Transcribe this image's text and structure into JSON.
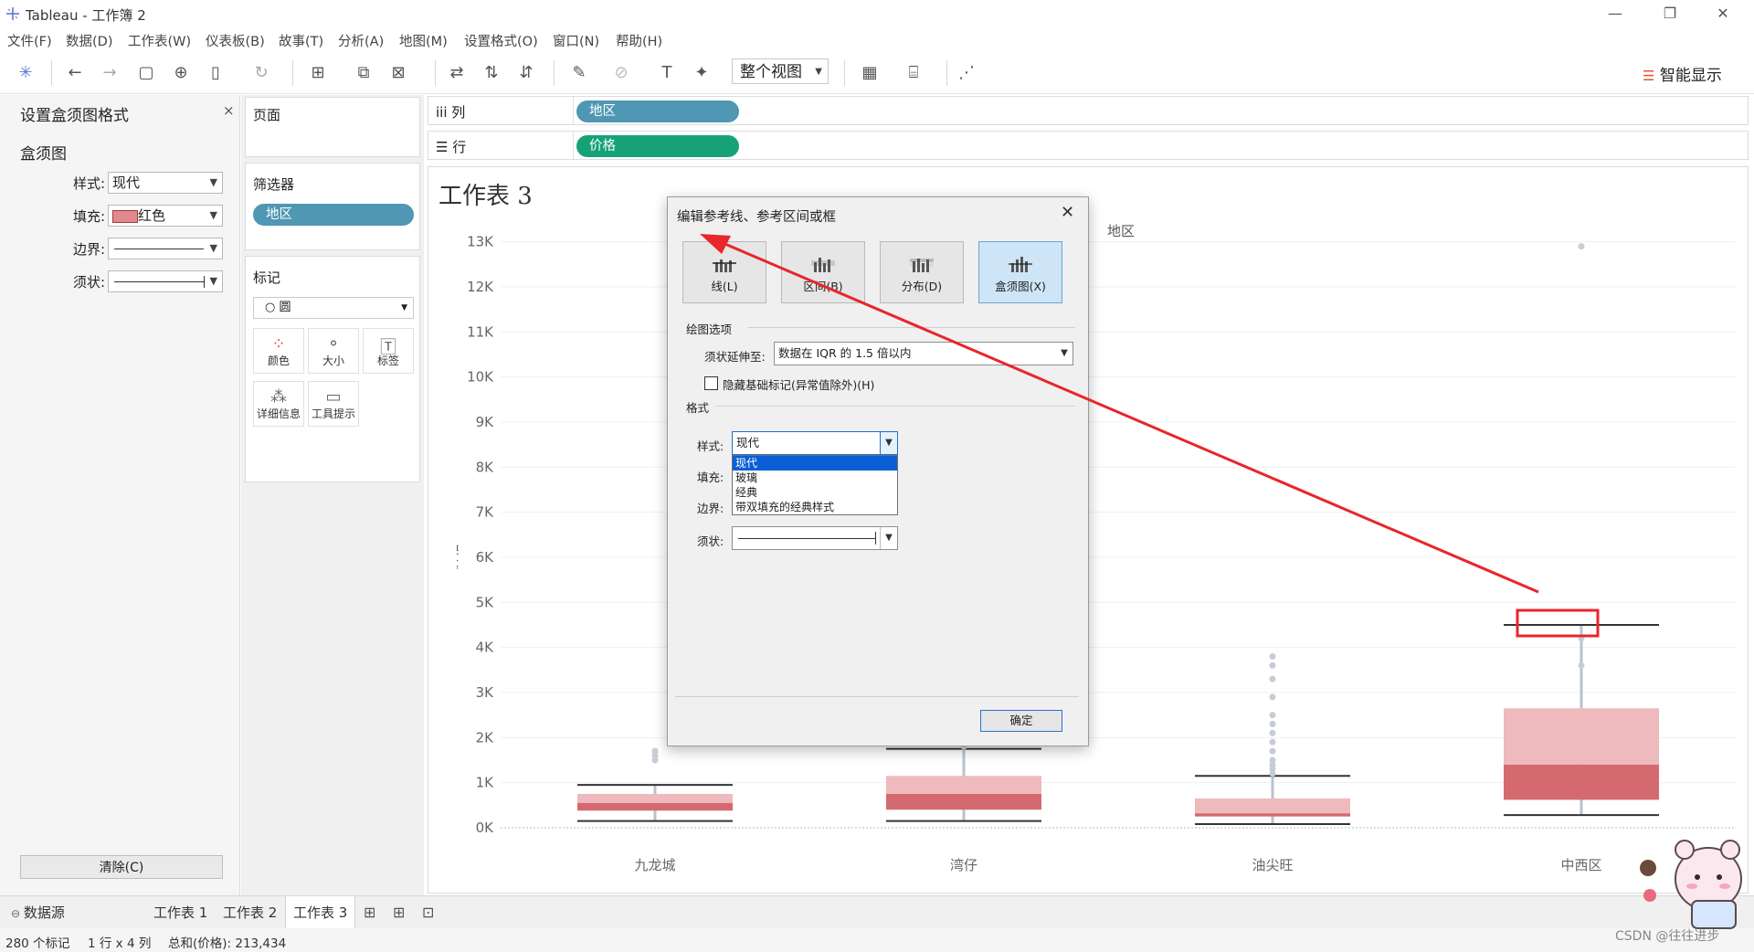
{
  "window": {
    "title": "Tableau - 工作簿 2",
    "controls": [
      "—",
      "❐",
      "✕"
    ]
  },
  "menu": [
    "文件(F)",
    "数据(D)",
    "工作表(W)",
    "仪表板(B)",
    "故事(T)",
    "分析(A)",
    "地图(M)",
    "设置格式(O)",
    "窗口(N)",
    "帮助(H)"
  ],
  "toolbar": {
    "fit": "整个视图",
    "smart_show": "智能显示"
  },
  "format_pane": {
    "title": "设置盒须图格式",
    "close": "×",
    "section": "盒须图",
    "rows": [
      {
        "label": "样式:",
        "value": "现代"
      },
      {
        "label": "填充:",
        "value": "红色",
        "swatch": "#e08a8f"
      },
      {
        "label": "边界:",
        "value": ""
      },
      {
        "label": "须状:",
        "value": ""
      }
    ],
    "clear": "清除(C)"
  },
  "cards": {
    "pages": "页面",
    "filters": "筛选器",
    "filter_pill": "地区",
    "marks": "标记",
    "mark_type": "○ 圆",
    "mark_buttons": [
      {
        "label": "颜色",
        "icon": "color-icon"
      },
      {
        "label": "大小",
        "icon": "size-icon"
      },
      {
        "label": "标签",
        "icon": "label-icon"
      },
      {
        "label": "详细信息",
        "icon": "detail-icon"
      },
      {
        "label": "工具提示",
        "icon": "tooltip-icon"
      }
    ]
  },
  "shelves": {
    "columns": {
      "label": "iii 列",
      "pill": "地区",
      "color": "#4f97b3"
    },
    "rows": {
      "label": "☰ 行",
      "pill": "价格",
      "color": "#17a176"
    }
  },
  "sheet": {
    "title": "工作表 3",
    "column_header": "地区"
  },
  "chart_data": {
    "type": "boxplot",
    "title": "",
    "xlabel": "",
    "ylabel": "价格",
    "ylim": [
      0,
      13500
    ],
    "y_ticks": [
      "0K",
      "1K",
      "2K",
      "3K",
      "4K",
      "5K",
      "6K",
      "7K",
      "8K",
      "9K",
      "10K",
      "11K",
      "12K",
      "13K"
    ],
    "categories": [
      "九龙城",
      "湾仔",
      "油尖旺",
      "中西区"
    ],
    "boxes": [
      {
        "min": 150,
        "q1": 380,
        "median": 550,
        "q3": 750,
        "max": 950,
        "outliers": [
          1500,
          1600,
          1700
        ]
      },
      {
        "min": 150,
        "q1": 400,
        "median": 750,
        "q3": 1150,
        "max": 1750,
        "outliers": [
          1800
        ]
      },
      {
        "min": 80,
        "q1": 250,
        "median": 320,
        "q3": 650,
        "max": 1150,
        "outliers": [
          1200,
          1300,
          1400,
          1500,
          1700,
          1900,
          2100,
          2300,
          2500,
          2900,
          3300,
          3600,
          3800
        ]
      },
      {
        "min": 280,
        "q1": 620,
        "median": 1400,
        "q3": 2650,
        "max": 4500,
        "outliers": [
          3600,
          4200,
          12900
        ]
      }
    ],
    "colors": {
      "upper_box": "#eebabd",
      "lower_box": "#d46a70",
      "whisker": "#333333",
      "outlier": "#c6ccd6",
      "highlight": "#e8262b"
    }
  },
  "dialog": {
    "title": "编辑参考线、参考区间或框",
    "close": "✕",
    "tabs": [
      {
        "label": "线(L)",
        "selected": false
      },
      {
        "label": "区间(B)",
        "selected": false
      },
      {
        "label": "分布(D)",
        "selected": false
      },
      {
        "label": "盒须图(X)",
        "selected": true
      }
    ],
    "plot_options": "绘图选项",
    "whisker_extend_label": "须状延伸至:",
    "whisker_extend_value": "数据在 IQR 的 1.5 倍以内",
    "hide_marks": "隐藏基础标记(异常值除外)(H)",
    "format_section": "格式",
    "style_label": "样式:",
    "style_value": "现代",
    "fill_label": "填充:",
    "border_label": "边界:",
    "whisker_label": "须状:",
    "style_options": [
      "现代",
      "玻璃",
      "经典",
      "带双填充的经典样式"
    ],
    "ok": "确定"
  },
  "tabs": [
    "数据源",
    "工作表 1",
    "工作表 2",
    "工作表 3"
  ],
  "status": {
    "marks": "280 个标记",
    "dims": "1 行 x 4 列",
    "sum": "总和(价格): 213,434"
  },
  "watermark": "CSDN @往往进步"
}
